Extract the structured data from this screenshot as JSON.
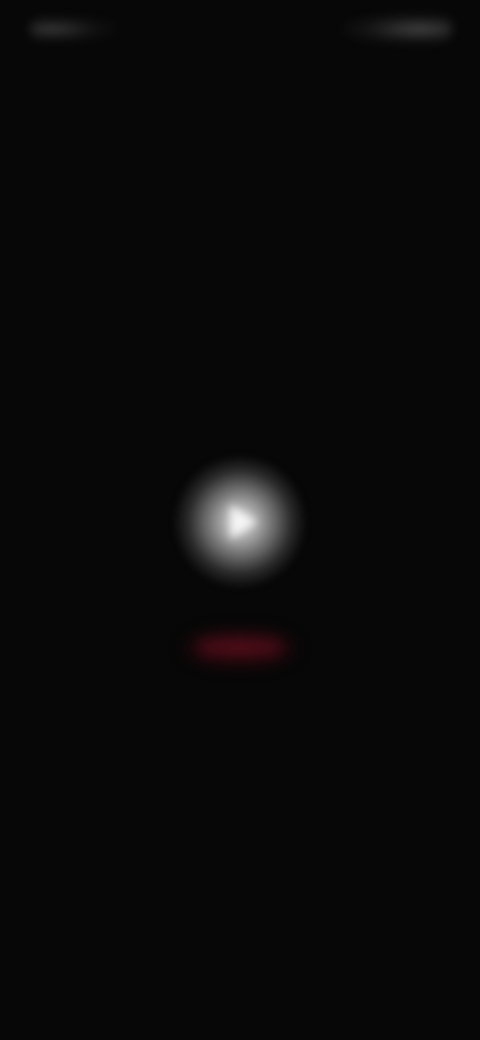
{
  "screen": {
    "state": "blurred-dark"
  },
  "status_bar": {
    "left_text": "",
    "right_text": ""
  },
  "center_controls": {
    "play_icon": "play-icon",
    "action_pill_text": ""
  },
  "colors": {
    "background": "#070707",
    "play_glow": "#d8d8d8",
    "action_pill": "#5e0f1b"
  }
}
